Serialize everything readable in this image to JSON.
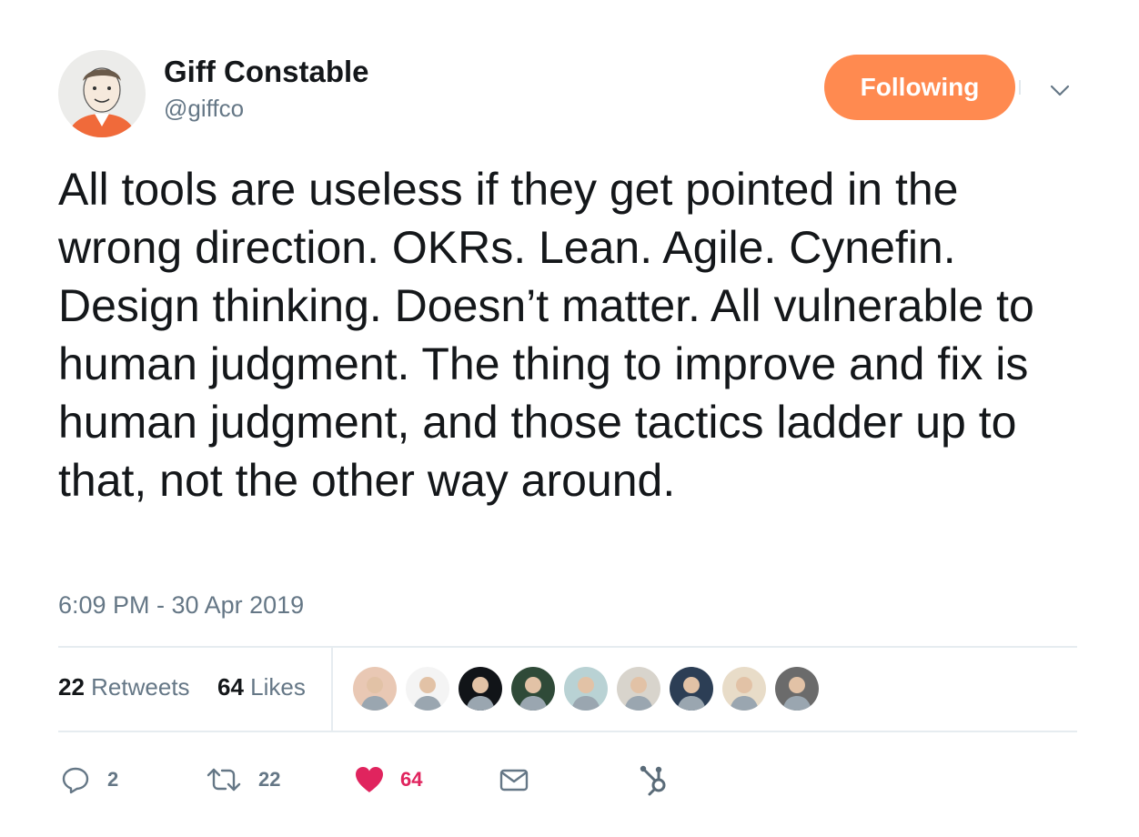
{
  "author": {
    "name": "Giff Constable",
    "handle": "@giffco",
    "avatar_icon": "author-cartoon-avatar"
  },
  "follow_button": {
    "label": "Following",
    "color": "#ff8a50"
  },
  "menu": {
    "icon": "chevron-down-icon"
  },
  "tweet": {
    "text": "All tools are useless if they get pointed in the wrong direction. OKRs. Lean. Agile. Cynefin. Design thinking. Doesn’t matter. All vulnerable to human judgment. The thing to improve and fix is human judgment, and those tactics ladder up to that, not the other way around.",
    "timestamp": "6:09 PM - 30 Apr 2019"
  },
  "stats": {
    "retweets_count": "22",
    "retweets_label": "Retweets",
    "likes_count": "64",
    "likes_label": "Likes"
  },
  "likers": [
    {
      "icon": "liker-avatar-1",
      "bg": "#e9c8b4"
    },
    {
      "icon": "liker-avatar-2",
      "bg": "#f4f4f4"
    },
    {
      "icon": "liker-avatar-3",
      "bg": "#111418"
    },
    {
      "icon": "liker-avatar-4",
      "bg": "#2f4a38"
    },
    {
      "icon": "liker-avatar-5",
      "bg": "#b9d2d4"
    },
    {
      "icon": "liker-avatar-6",
      "bg": "#d8d4cc"
    },
    {
      "icon": "liker-avatar-7",
      "bg": "#2c3e55"
    },
    {
      "icon": "liker-avatar-8",
      "bg": "#e8dcc8"
    },
    {
      "icon": "liker-avatar-9",
      "bg": "#6b6b6b"
    }
  ],
  "actions": {
    "reply_count": "2",
    "retweet_count": "22",
    "like_count": "64",
    "like_color": "#e0245e"
  }
}
